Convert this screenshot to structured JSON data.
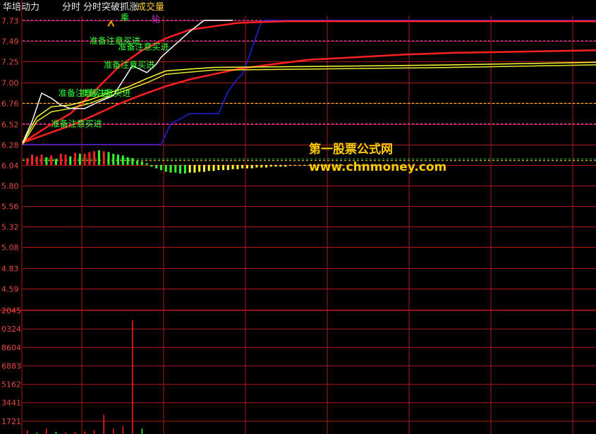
{
  "header": {
    "stock_name": "华培动力",
    "view_label": "分时",
    "indicator_name": "分时突破抓涨",
    "volume_label": "成交量"
  },
  "watermark": {
    "line1": "第一股票公式网",
    "line2": "www.chnmoney.com"
  },
  "colors": {
    "background": "#000000",
    "grid": "#b01818",
    "price_line": "#ffffff",
    "avg_line": "#ffff33",
    "signal_text": "#33ff33",
    "label_magenta": "#cc33cc",
    "marker_orange": "#ff9900",
    "blue_line": "#2020e0",
    "red_line": "#ff2020",
    "watermark": "#ffcc00"
  },
  "chart_data": [
    {
      "type": "line",
      "name": "price-panel",
      "y_ticks": [
        "7.73",
        "7.49",
        "7.25",
        "7.00",
        "6.76",
        "6.52",
        "6.28",
        "6.04",
        "5.80",
        "5.56",
        "5.32",
        "5.08",
        "4.83",
        "4.59"
      ],
      "ylim": [
        4.47,
        7.77
      ],
      "xlim": [
        0,
        240
      ],
      "reference_levels": [
        7.73,
        7.49,
        6.76,
        6.52
      ],
      "series": [
        {
          "role": "price",
          "color": "#ffffff",
          "x": [
            0,
            4,
            8,
            12,
            16,
            20,
            26,
            32,
            38,
            46,
            52,
            56,
            58,
            64,
            70,
            76,
            80,
            84,
            88
          ],
          "y": [
            6.3,
            6.55,
            6.88,
            6.82,
            6.74,
            6.7,
            6.7,
            6.78,
            6.85,
            7.2,
            7.12,
            7.22,
            7.3,
            7.45,
            7.6,
            7.73,
            7.73,
            7.73,
            7.73
          ]
        },
        {
          "role": "average",
          "color": "#ffff33",
          "x": [
            0,
            6,
            12,
            20,
            28,
            36,
            44,
            52,
            60,
            80,
            120,
            180,
            240
          ],
          "y": [
            6.3,
            6.6,
            6.72,
            6.74,
            6.8,
            6.88,
            6.95,
            7.05,
            7.14,
            7.18,
            7.19,
            7.21,
            7.24
          ]
        },
        {
          "role": "average-2",
          "color": "#e6e62e",
          "x": [
            0,
            6,
            12,
            20,
            28,
            36,
            44,
            52,
            60,
            80,
            120,
            180,
            240
          ],
          "y": [
            6.28,
            6.55,
            6.66,
            6.7,
            6.76,
            6.84,
            6.92,
            7.0,
            7.1,
            7.15,
            7.16,
            7.18,
            7.21
          ]
        },
        {
          "role": "slow-line",
          "color": "#ff2020",
          "x": [
            0,
            10,
            20,
            30,
            40,
            50,
            60,
            70,
            80,
            90,
            100,
            120,
            140,
            160,
            180,
            200,
            220,
            240
          ],
          "y": [
            6.3,
            6.4,
            6.5,
            6.62,
            6.75,
            6.86,
            6.96,
            7.04,
            7.1,
            7.16,
            7.2,
            7.27,
            7.3,
            7.33,
            7.35,
            7.36,
            7.37,
            7.38
          ]
        },
        {
          "role": "fast-line",
          "color": "#ff2020",
          "x": [
            0,
            10,
            20,
            30,
            40,
            50,
            60,
            70,
            80,
            90,
            100,
            110,
            240
          ],
          "y": [
            6.3,
            6.48,
            6.64,
            6.9,
            7.18,
            7.38,
            7.52,
            7.62,
            7.66,
            7.7,
            7.71,
            7.72,
            7.72
          ]
        },
        {
          "role": "step-line",
          "color": "#2020e0",
          "x": [
            0,
            58,
            62,
            70,
            82,
            86,
            90,
            92,
            96,
            100,
            102,
            240
          ],
          "y": [
            6.28,
            6.28,
            6.52,
            6.64,
            6.64,
            6.9,
            7.05,
            7.1,
            7.4,
            7.72,
            7.73,
            7.73
          ]
        }
      ],
      "annotations": [
        {
          "text": "准备注意买进",
          "x": 12,
          "y": 6.52
        },
        {
          "text": "准备注意买进",
          "x": 15,
          "y": 6.88
        },
        {
          "text": "准备注意买进",
          "x": 24,
          "y": 6.88
        },
        {
          "text": "准备注意买进",
          "x": 34,
          "y": 7.21
        },
        {
          "text": "准备注意买进",
          "x": 28,
          "y": 7.49
        },
        {
          "text": "准备注意买进",
          "x": 40,
          "y": 7.42
        }
      ],
      "markers": [
        {
          "text": "乘",
          "x": 41,
          "y": 7.76
        },
        {
          "text": "轮",
          "x": 54,
          "y": 7.74
        }
      ],
      "histogram": {
        "baseline": 6.04,
        "x": [
          2,
          4,
          6,
          8,
          10,
          12,
          14,
          16,
          18,
          20,
          22,
          24,
          26,
          28,
          30,
          32,
          34,
          36,
          38,
          40,
          42,
          44,
          46,
          48,
          50,
          52,
          54,
          56,
          58,
          60,
          62,
          64,
          66,
          68,
          70,
          72,
          74,
          76,
          78,
          80,
          82,
          84,
          86,
          88,
          90,
          92,
          94,
          96,
          98,
          100,
          102,
          104,
          106,
          108,
          110,
          112,
          114,
          116,
          118,
          120,
          122,
          124,
          126,
          128,
          130,
          132,
          134,
          136,
          138,
          140,
          142,
          144,
          146,
          148,
          150
        ],
        "values": [
          0.08,
          0.12,
          0.1,
          0.12,
          0.09,
          0.11,
          0.07,
          0.13,
          0.12,
          0.1,
          0.14,
          0.13,
          0.13,
          0.15,
          0.16,
          0.17,
          0.16,
          0.15,
          0.13,
          0.12,
          0.11,
          0.09,
          0.08,
          0.05,
          0.04,
          0.02,
          -0.02,
          -0.04,
          -0.06,
          -0.08,
          -0.09,
          -0.09,
          -0.1,
          -0.1,
          -0.09,
          -0.09,
          -0.08,
          -0.08,
          -0.07,
          -0.07,
          -0.06,
          -0.06,
          -0.06,
          -0.05,
          -0.05,
          -0.04,
          -0.04,
          -0.04,
          -0.03,
          -0.03,
          -0.03,
          -0.02,
          -0.02,
          -0.02,
          -0.02,
          -0.01,
          -0.01,
          -0.01,
          -0.01,
          -0.01,
          -0.01,
          -0.01,
          -0.01,
          -0.01,
          -0.01,
          -0.005,
          -0.005,
          -0.005,
          -0.005,
          -0.005,
          -0.005,
          -0.005,
          -0.005,
          -0.005,
          -0.005
        ],
        "colors": [
          "#ff2020",
          "#ff2020",
          "#ff2020",
          "#ff2020",
          "#33ff33",
          "#ff2020",
          "#33ff33",
          "#ff2020",
          "#ff2020",
          "#33ff33",
          "#ff2020",
          "#33ff33",
          "#ff2020",
          "#ff2020",
          "#ff2020",
          "#33ff33",
          "#ff2020",
          "#33ff33",
          "#33ff33",
          "#33ff33",
          "#33ff33",
          "#33ff33",
          "#33ff33",
          "#33ff33",
          "#33ff33",
          "#33ff33",
          "#33ff33",
          "#33ff33",
          "#33ff33",
          "#33ff33",
          "#33ff33",
          "#33ff33",
          "#33ff33",
          "#33ff33",
          "#ffff33",
          "#ffff33",
          "#ffff33",
          "#ffff33",
          "#ffff33",
          "#ffff33",
          "#ffff33",
          "#ffff33",
          "#ffff33",
          "#ffff33",
          "#ffff33",
          "#ffff33",
          "#ffff33",
          "#ffff33",
          "#ffff33",
          "#ffff33",
          "#ffff33",
          "#ffff33",
          "#ffff33",
          "#ffff33",
          "#ffff33",
          "#ffff33",
          "#ffff33",
          "#ffff33",
          "#ffff33",
          "#ffff33",
          "#ffff33",
          "#ffff33",
          "#ffff33",
          "#ffff33",
          "#ffff33",
          "#ffff33",
          "#ffff33",
          "#ffff33",
          "#ffff33",
          "#ffff33",
          "#ffff33",
          "#ffff33",
          "#ffff33",
          "#ffff33",
          "#ffff33"
        ]
      }
    },
    {
      "type": "bar",
      "name": "volume-panel",
      "y_ticks": [
        "2045",
        "0324",
        "8604",
        "6883",
        "5162",
        "3441",
        "1721"
      ],
      "ylim": [
        0,
        2045
      ],
      "xlim": [
        0,
        240
      ],
      "x": [
        2,
        6,
        10,
        14,
        18,
        22,
        26,
        30,
        34,
        38,
        42,
        46,
        50
      ],
      "values": [
        60,
        20,
        90,
        35,
        25,
        30,
        45,
        60,
        320,
        90,
        130,
        1880,
        90
      ],
      "colors": [
        "#ff2020",
        "#33ff33",
        "#ff2020",
        "#33ff33",
        "#ff2020",
        "#ff2020",
        "#ff2020",
        "#ff2020",
        "#ff2020",
        "#ff2020",
        "#ff2020",
        "#ff2020",
        "#33ff33"
      ]
    }
  ]
}
